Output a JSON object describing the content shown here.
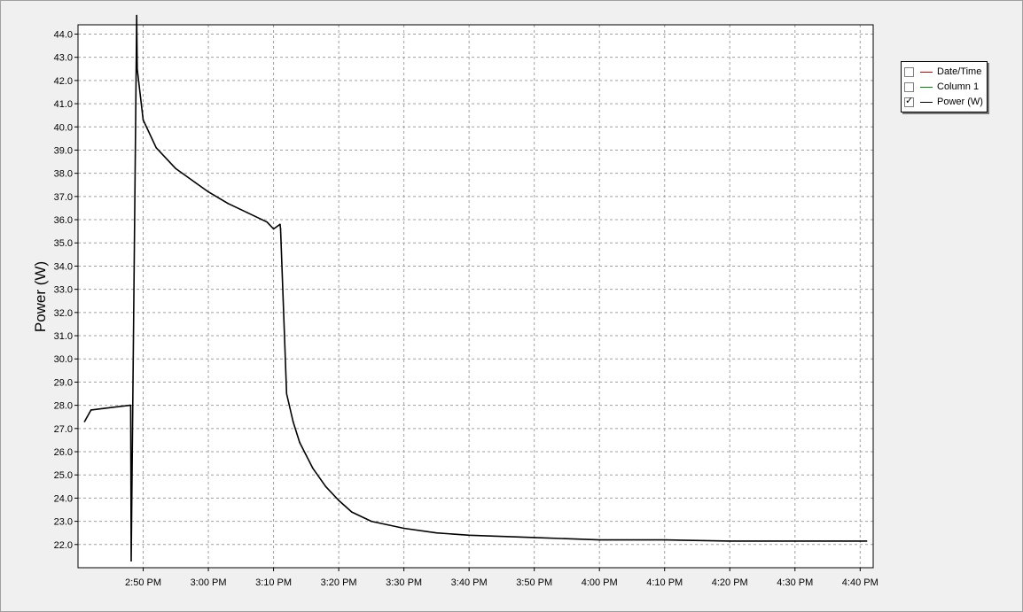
{
  "chart_data": {
    "type": "line",
    "ylabel": "Power (W)",
    "ylim": [
      21.0,
      44.4
    ],
    "y_ticks": [
      "22.0",
      "23.0",
      "24.0",
      "25.0",
      "26.0",
      "27.0",
      "28.0",
      "29.0",
      "30.0",
      "31.0",
      "32.0",
      "33.0",
      "34.0",
      "35.0",
      "36.0",
      "37.0",
      "38.0",
      "39.0",
      "40.0",
      "41.0",
      "42.0",
      "43.0",
      "44.0"
    ],
    "x_ticks": [
      "2:50 PM",
      "3:00 PM",
      "3:10 PM",
      "3:20 PM",
      "3:30 PM",
      "3:40 PM",
      "3:50 PM",
      "4:00 PM",
      "4:10 PM",
      "4:20 PM",
      "4:30 PM",
      "4:40 PM"
    ],
    "xlim": [
      "2:40 PM",
      "4:42 PM"
    ],
    "grid": true,
    "legend_position": "right",
    "series": [
      {
        "name": "Power (W)",
        "color": "#000000",
        "x": [
          "2:41 PM",
          "2:42 PM",
          "2:45 PM",
          "2:48 PM",
          "2:48 PM",
          "2:48 PM",
          "2:49 PM",
          "2:49 PM",
          "2:50 PM",
          "2:52 PM",
          "2:55 PM",
          "2:58 PM",
          "3:00 PM",
          "3:03 PM",
          "3:06 PM",
          "3:09 PM",
          "3:10 PM",
          "3:11 PM",
          "3:11 PM",
          "3:12 PM",
          "3:13 PM",
          "3:14 PM",
          "3:16 PM",
          "3:18 PM",
          "3:20 PM",
          "3:22 PM",
          "3:25 PM",
          "3:30 PM",
          "3:35 PM",
          "3:40 PM",
          "3:50 PM",
          "4:00 PM",
          "4:10 PM",
          "4:20 PM",
          "4:30 PM",
          "4:41 PM"
        ],
        "values": [
          27.3,
          27.8,
          27.9,
          28.0,
          28.0,
          21.3,
          44.8,
          42.5,
          40.3,
          39.1,
          38.2,
          37.6,
          37.2,
          36.7,
          36.3,
          35.9,
          35.6,
          35.8,
          35.6,
          28.5,
          27.3,
          26.4,
          25.3,
          24.5,
          23.9,
          23.4,
          23.0,
          22.7,
          22.5,
          22.4,
          22.3,
          22.2,
          22.2,
          22.15,
          22.15,
          22.15
        ]
      }
    ]
  },
  "legend": {
    "items": [
      {
        "label": "Date/Time",
        "checked": "",
        "color": "#d40000"
      },
      {
        "label": "Column 1",
        "checked": "",
        "color": "#008a00"
      },
      {
        "label": "Power (W)",
        "checked": "✓",
        "color": "#000000"
      }
    ]
  }
}
